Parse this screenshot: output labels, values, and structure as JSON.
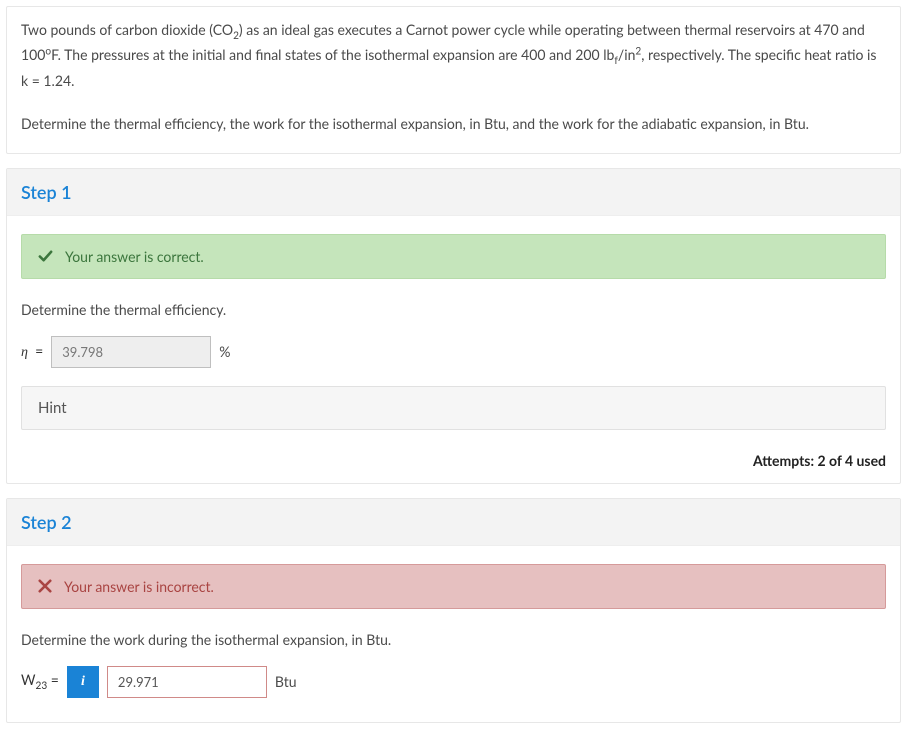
{
  "problem": {
    "text_html": "Two pounds of carbon dioxide (CO<sub>2</sub>) as an ideal gas executes a Carnot power cycle while operating between thermal reservoirs at 470 and 100<sup>o</sup>F. The pressures at the initial and final states of the isothermal expansion are 400 and 200 lb<sub>f</sub>/in<sup>2</sup>, respectively. The specific heat ratio is k = 1.24.",
    "task_html": "Determine the thermal efficiency, the work for the isothermal expansion, in Btu, and the work for the adiabatic expansion, in Btu."
  },
  "step1": {
    "title": "Step 1",
    "alert": "Your answer is correct.",
    "prompt": "Determine the thermal efficiency.",
    "var_label_html": "<span class=\"eta\">&eta;</span> &nbsp;=",
    "value": "39.798",
    "unit": "%",
    "hint_label": "Hint",
    "attempts": "Attempts: 2 of 4 used"
  },
  "step2": {
    "title": "Step 2",
    "alert": "Your answer is incorrect.",
    "prompt": "Determine the work during the isothermal expansion, in Btu.",
    "var_label_html": "W<sub>23</sub> =",
    "info_icon": "i",
    "value": "29.971",
    "unit": "Btu"
  }
}
